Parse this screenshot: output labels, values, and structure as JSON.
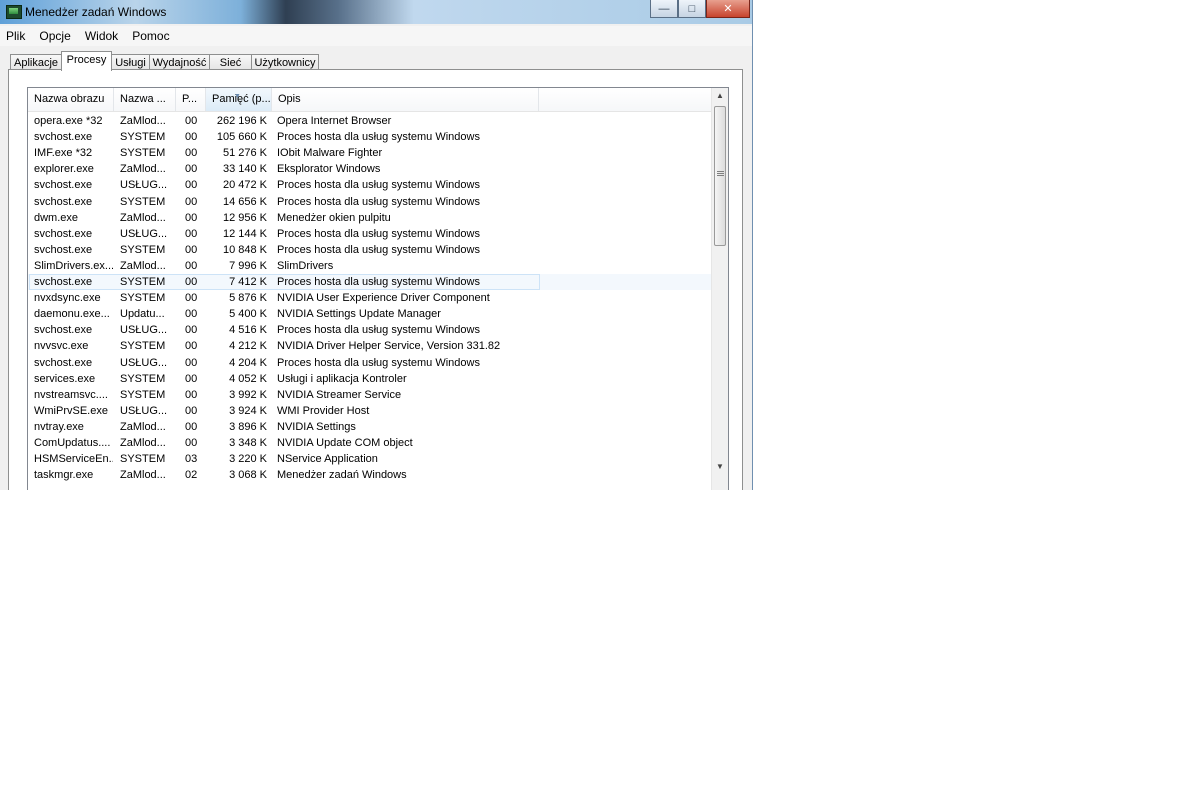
{
  "window": {
    "title": "Menedżer zadań Windows",
    "min": "—",
    "max": "□",
    "close": "✕"
  },
  "menu": [
    "Plik",
    "Opcje",
    "Widok",
    "Pomoc"
  ],
  "tabs": [
    "Aplikacje",
    "Procesy",
    "Usługi",
    "Wydajność",
    "Sieć",
    "Użytkownicy"
  ],
  "active_tab": "Procesy",
  "columns": [
    "Nazwa obrazu",
    "Nazwa ...",
    "P...",
    "Pamięć (p...",
    "Opis"
  ],
  "sorted_column": "Pamięć (p...",
  "rows": [
    {
      "image": "opera.exe *32",
      "user": "ZaMlod...",
      "cpu": "00",
      "mem": "262 196 K",
      "desc": "Opera Internet Browser"
    },
    {
      "image": "svchost.exe",
      "user": "SYSTEM",
      "cpu": "00",
      "mem": "105 660 K",
      "desc": "Proces hosta dla usług systemu Windows"
    },
    {
      "image": "IMF.exe *32",
      "user": "SYSTEM",
      "cpu": "00",
      "mem": "51 276 K",
      "desc": "IObit Malware Fighter"
    },
    {
      "image": "explorer.exe",
      "user": "ZaMlod...",
      "cpu": "00",
      "mem": "33 140 K",
      "desc": "Eksplorator Windows"
    },
    {
      "image": "svchost.exe",
      "user": "USŁUG...",
      "cpu": "00",
      "mem": "20 472 K",
      "desc": "Proces hosta dla usług systemu Windows"
    },
    {
      "image": "svchost.exe",
      "user": "SYSTEM",
      "cpu": "00",
      "mem": "14 656 K",
      "desc": "Proces hosta dla usług systemu Windows"
    },
    {
      "image": "dwm.exe",
      "user": "ZaMlod...",
      "cpu": "00",
      "mem": "12 956 K",
      "desc": "Menedżer okien pulpitu"
    },
    {
      "image": "svchost.exe",
      "user": "USŁUG...",
      "cpu": "00",
      "mem": "12 144 K",
      "desc": "Proces hosta dla usług systemu Windows"
    },
    {
      "image": "svchost.exe",
      "user": "SYSTEM",
      "cpu": "00",
      "mem": "10 848 K",
      "desc": "Proces hosta dla usług systemu Windows"
    },
    {
      "image": "SlimDrivers.ex...",
      "user": "ZaMlod...",
      "cpu": "00",
      "mem": "7 996 K",
      "desc": "SlimDrivers"
    },
    {
      "image": "svchost.exe",
      "user": "SYSTEM",
      "cpu": "00",
      "mem": "7 412 K",
      "desc": "Proces hosta dla usług systemu Windows",
      "selected": true
    },
    {
      "image": "nvxdsync.exe",
      "user": "SYSTEM",
      "cpu": "00",
      "mem": "5 876 K",
      "desc": "NVIDIA User Experience Driver Component"
    },
    {
      "image": "daemonu.exe...",
      "user": "Updatu...",
      "cpu": "00",
      "mem": "5 400 K",
      "desc": "NVIDIA Settings Update Manager"
    },
    {
      "image": "svchost.exe",
      "user": "USŁUG...",
      "cpu": "00",
      "mem": "4 516 K",
      "desc": "Proces hosta dla usług systemu Windows"
    },
    {
      "image": "nvvsvc.exe",
      "user": "SYSTEM",
      "cpu": "00",
      "mem": "4 212 K",
      "desc": "NVIDIA Driver Helper Service, Version 331.82"
    },
    {
      "image": "svchost.exe",
      "user": "USŁUG...",
      "cpu": "00",
      "mem": "4 204 K",
      "desc": "Proces hosta dla usług systemu Windows"
    },
    {
      "image": "services.exe",
      "user": "SYSTEM",
      "cpu": "00",
      "mem": "4 052 K",
      "desc": "Usługi i aplikacja Kontroler"
    },
    {
      "image": "nvstreamsvc....",
      "user": "SYSTEM",
      "cpu": "00",
      "mem": "3 992 K",
      "desc": "NVIDIA Streamer Service"
    },
    {
      "image": "WmiPrvSE.exe",
      "user": "USŁUG...",
      "cpu": "00",
      "mem": "3 924 K",
      "desc": "WMI Provider Host"
    },
    {
      "image": "nvtray.exe",
      "user": "ZaMlod...",
      "cpu": "00",
      "mem": "3 896 K",
      "desc": "NVIDIA Settings"
    },
    {
      "image": "ComUpdatus....",
      "user": "ZaMlod...",
      "cpu": "00",
      "mem": "3 348 K",
      "desc": "NVIDIA Update COM object"
    },
    {
      "image": "HSMServiceEn...",
      "user": "SYSTEM",
      "cpu": "03",
      "mem": "3 220 K",
      "desc": "NService Application"
    },
    {
      "image": "taskmgr.exe",
      "user": "ZaMlod...",
      "cpu": "02",
      "mem": "3 068 K",
      "desc": "Menedżer zadań Windows"
    }
  ]
}
